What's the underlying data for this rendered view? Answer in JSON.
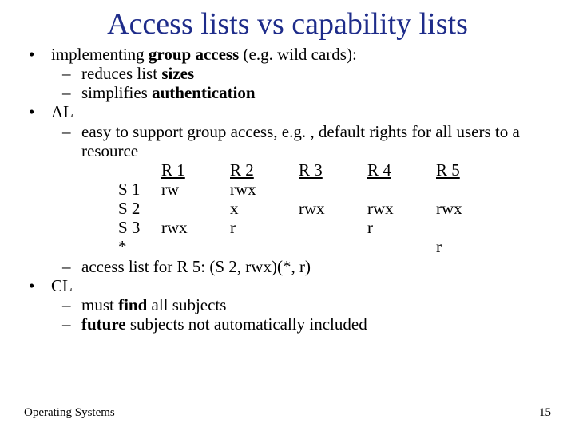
{
  "title": "Access lists vs capability lists",
  "b1": {
    "pre": "implementing ",
    "strong": "group access",
    "post": " (e.g. wild cards):"
  },
  "b1s1": {
    "pre": "reduces list ",
    "strong": "sizes"
  },
  "b1s2": {
    "pre": "simplifies ",
    "strong": "authentication"
  },
  "b2": "AL",
  "b2s1": "easy to support group access, e.g. , default rights for all users to a resource",
  "table": {
    "headers": [
      "R 1",
      "R 2",
      "R 3",
      "R 4",
      "R 5"
    ],
    "rows": [
      {
        "s": "S 1",
        "c": [
          "rw",
          "rwx",
          "",
          "",
          ""
        ]
      },
      {
        "s": "S 2",
        "c": [
          "",
          "x",
          "rwx",
          "rwx",
          "rwx"
        ]
      },
      {
        "s": "S 3",
        "c": [
          "rwx",
          "r",
          "",
          "r",
          ""
        ]
      },
      {
        "s": "*",
        "c": [
          "",
          "",
          "",
          "",
          "r"
        ]
      }
    ]
  },
  "b2s2": "access list for R 5: (S 2, rwx)(*, r)",
  "b3": "CL",
  "b3s1": {
    "pre": "must ",
    "strong": "find",
    "post": " all subjects"
  },
  "b3s2": {
    "strong": "future",
    "post": " subjects not automatically included"
  },
  "footer_left": "Operating Systems",
  "footer_right": "15"
}
